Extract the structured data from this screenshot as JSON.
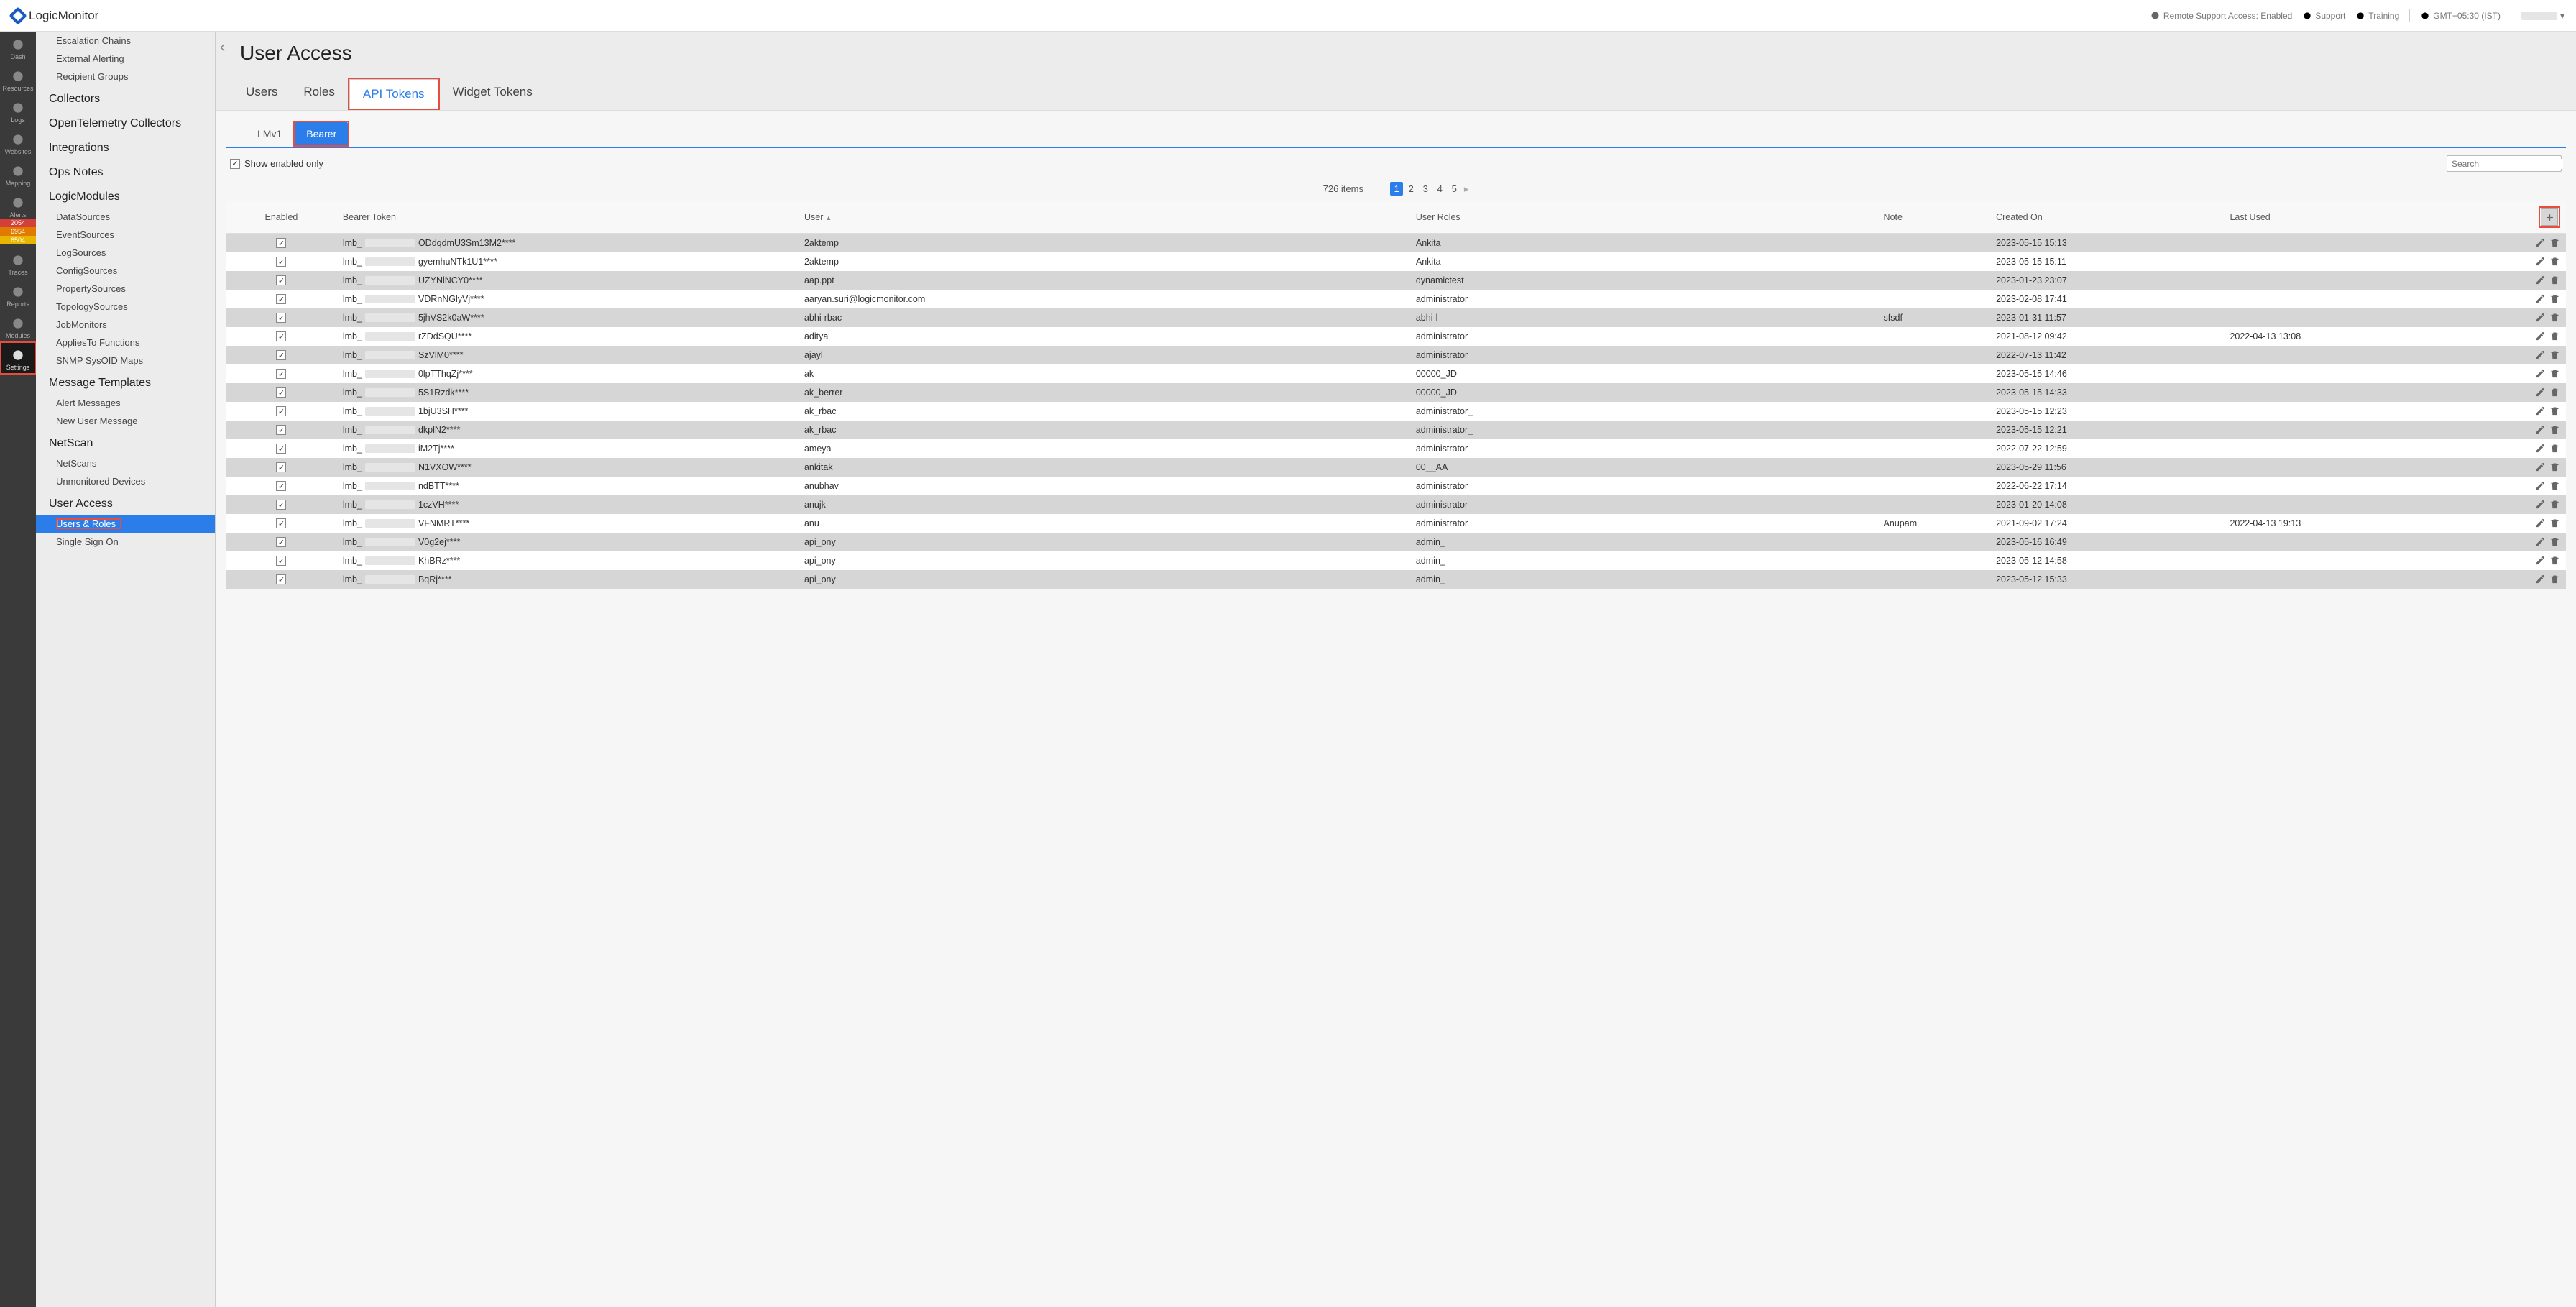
{
  "brand": "LogicMonitor",
  "top": {
    "remote_support": "Remote Support Access: Enabled",
    "support": "Support",
    "training": "Training",
    "timezone": "GMT+05:30 (IST)"
  },
  "rail": [
    {
      "label": "Dash"
    },
    {
      "label": "Resources"
    },
    {
      "label": "Logs"
    },
    {
      "label": "Websites"
    },
    {
      "label": "Mapping"
    },
    {
      "label": "Alerts",
      "badges": [
        "2054",
        "6954",
        "6504"
      ]
    },
    {
      "label": "Traces"
    },
    {
      "label": "Reports"
    },
    {
      "label": "Modules"
    },
    {
      "label": "Settings",
      "active": true
    }
  ],
  "sidebar_top": [
    "Escalation Chains",
    "External Alerting",
    "Recipient Groups"
  ],
  "sidebar_groups": [
    {
      "title": "Collectors"
    },
    {
      "title": "OpenTelemetry Collectors"
    },
    {
      "title": "Integrations"
    },
    {
      "title": "Ops Notes"
    },
    {
      "title": "LogicModules",
      "subs": [
        "DataSources",
        "EventSources",
        "LogSources",
        "ConfigSources",
        "PropertySources",
        "TopologySources",
        "JobMonitors",
        "AppliesTo Functions",
        "SNMP SysOID Maps"
      ]
    },
    {
      "title": "Message Templates",
      "subs": [
        "Alert Messages",
        "New User Message"
      ]
    },
    {
      "title": "NetScan",
      "subs": [
        "NetScans",
        "Unmonitored Devices"
      ]
    },
    {
      "title": "User Access",
      "subs": [
        "Users & Roles",
        "Single Sign On"
      ],
      "selected_sub": 0
    }
  ],
  "page_title": "User Access",
  "tabs": [
    "Users",
    "Roles",
    "API Tokens",
    "Widget Tokens"
  ],
  "active_tab": 2,
  "subtabs": [
    "LMv1",
    "Bearer"
  ],
  "active_subtab": 1,
  "show_enabled_label": "Show enabled only",
  "show_enabled_checked": true,
  "search_placeholder": "Search",
  "item_count": "726 items",
  "pages": [
    "1",
    "2",
    "3",
    "4",
    "5"
  ],
  "active_page": 0,
  "columns": {
    "enabled": "Enabled",
    "token": "Bearer Token",
    "user": "User",
    "roles": "User Roles",
    "note": "Note",
    "created": "Created On",
    "last": "Last Used"
  },
  "rows": [
    {
      "pre": "lmb_",
      "suf": "ODdqdmU3Sm13M2****",
      "user": "2aktemp",
      "roles": "Ankita",
      "note": "",
      "created": "2023-05-15 15:13",
      "last": ""
    },
    {
      "pre": "lmb_",
      "suf": "gyemhuNTk1U1****",
      "user": "2aktemp",
      "roles": "Ankita",
      "note": "",
      "created": "2023-05-15 15:11",
      "last": ""
    },
    {
      "pre": "lmb_",
      "suf": "UZYNlNCY0****",
      "user": "aap.ppt",
      "roles": "dynamictest",
      "note": "",
      "created": "2023-01-23 23:07",
      "last": ""
    },
    {
      "pre": "lmb_",
      "suf": "VDRnNGlyVj****",
      "user": "aaryan.suri@logicmonitor.com",
      "roles": "administrator",
      "note": "",
      "created": "2023-02-08 17:41",
      "last": ""
    },
    {
      "pre": "lmb_",
      "suf": "5jhVS2k0aW****",
      "user": "abhi-rbac",
      "roles": "abhi-l",
      "note": "sfsdf",
      "created": "2023-01-31 11:57",
      "last": ""
    },
    {
      "pre": "lmb_",
      "suf": "rZDdSQU****",
      "user": "aditya",
      "roles": "administrator",
      "note": "",
      "created": "2021-08-12 09:42",
      "last": "2022-04-13 13:08"
    },
    {
      "pre": "lmb_",
      "suf": "SzVlM0****",
      "user": "ajayl",
      "roles": "administrator",
      "note": "",
      "created": "2022-07-13 11:42",
      "last": ""
    },
    {
      "pre": "lmb_",
      "suf": "0lpTThqZj****",
      "user": "ak",
      "roles": "00000_JD",
      "note": "",
      "created": "2023-05-15 14:46",
      "last": ""
    },
    {
      "pre": "lmb_",
      "suf": "5S1Rzdk****",
      "user": "ak_berrer",
      "roles": "00000_JD",
      "note": "",
      "created": "2023-05-15 14:33",
      "last": ""
    },
    {
      "pre": "lmb_",
      "suf": "1bjU3SH****",
      "user": "ak_rbac",
      "roles": "administrator_",
      "note": "",
      "created": "2023-05-15 12:23",
      "last": ""
    },
    {
      "pre": "lmb_",
      "suf": "dkplN2****",
      "user": "ak_rbac",
      "roles": "administrator_",
      "note": "",
      "created": "2023-05-15 12:21",
      "last": ""
    },
    {
      "pre": "lmb_",
      "suf": "iM2Tj****",
      "user": "ameya",
      "roles": "administrator",
      "note": "",
      "created": "2022-07-22 12:59",
      "last": ""
    },
    {
      "pre": "lmb_",
      "suf": "N1VXOW****",
      "user": "ankitak",
      "roles": "00__AA",
      "note": "",
      "created": "2023-05-29 11:56",
      "last": ""
    },
    {
      "pre": "lmb_",
      "suf": "ndBTT****",
      "user": "anubhav",
      "roles": "administrator",
      "note": "",
      "created": "2022-06-22 17:14",
      "last": ""
    },
    {
      "pre": "lmb_",
      "suf": "1czVH****",
      "user": "anujk",
      "roles": "administrator",
      "note": "",
      "created": "2023-01-20 14:08",
      "last": ""
    },
    {
      "pre": "lmb_",
      "suf": "VFNMRT****",
      "user": "anu",
      "roles": "administrator",
      "note": "Anupam",
      "created": "2021-09-02 17:24",
      "last": "2022-04-13 19:13"
    },
    {
      "pre": "lmb_",
      "suf": "V0g2ej****",
      "user": "api_ony",
      "roles": "admin_",
      "note": "",
      "created": "2023-05-16 16:49",
      "last": ""
    },
    {
      "pre": "lmb_",
      "suf": "KhBRz****",
      "user": "api_ony",
      "roles": "admin_",
      "note": "",
      "created": "2023-05-12 14:58",
      "last": ""
    },
    {
      "pre": "lmb_",
      "suf": "BqRj****",
      "user": "api_ony",
      "roles": "admin_",
      "note": "",
      "created": "2023-05-12 15:33",
      "last": ""
    }
  ]
}
